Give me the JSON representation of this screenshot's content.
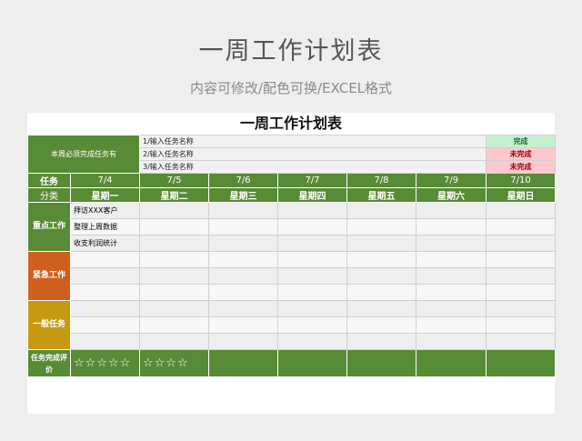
{
  "banner": {
    "title": "一周工作计划表",
    "subtitle": "内容可修改/配色可换/EXCEL格式"
  },
  "sheet": {
    "title": "一周工作计划表",
    "summary_label": "本周必须完成任务有",
    "tasks": [
      {
        "text": "1/输入任务名称",
        "status": "完成"
      },
      {
        "text": "2/输入任务名称",
        "status": "未完成"
      },
      {
        "text": "3/输入任务名称",
        "status": "未完成"
      }
    ],
    "header": {
      "label_top": "任务",
      "label_bottom": "分类",
      "dates": [
        "7/4",
        "7/5",
        "7/6",
        "7/7",
        "7/8",
        "7/9",
        "7/10"
      ],
      "weekdays": [
        "星期一",
        "星期二",
        "星期三",
        "星期四",
        "星期五",
        "星期六",
        "星期日"
      ]
    },
    "categories": {
      "key": "重点工作",
      "urgent": "紧急工作",
      "normal": "一般任务"
    },
    "key_items": [
      "拜访XXX客户",
      "整理上周数据",
      "收支利润统计"
    ],
    "evaluation": {
      "label": "任务完成评价",
      "ratings": [
        "☆☆☆☆☆",
        "☆☆☆☆",
        "",
        "",
        "",
        "",
        ""
      ]
    },
    "colors": {
      "green": "#588b35",
      "orange": "#cf5f1e",
      "gold": "#c59a10",
      "done_bg": "#c6efce",
      "undone_bg": "#ffc7ce"
    }
  }
}
